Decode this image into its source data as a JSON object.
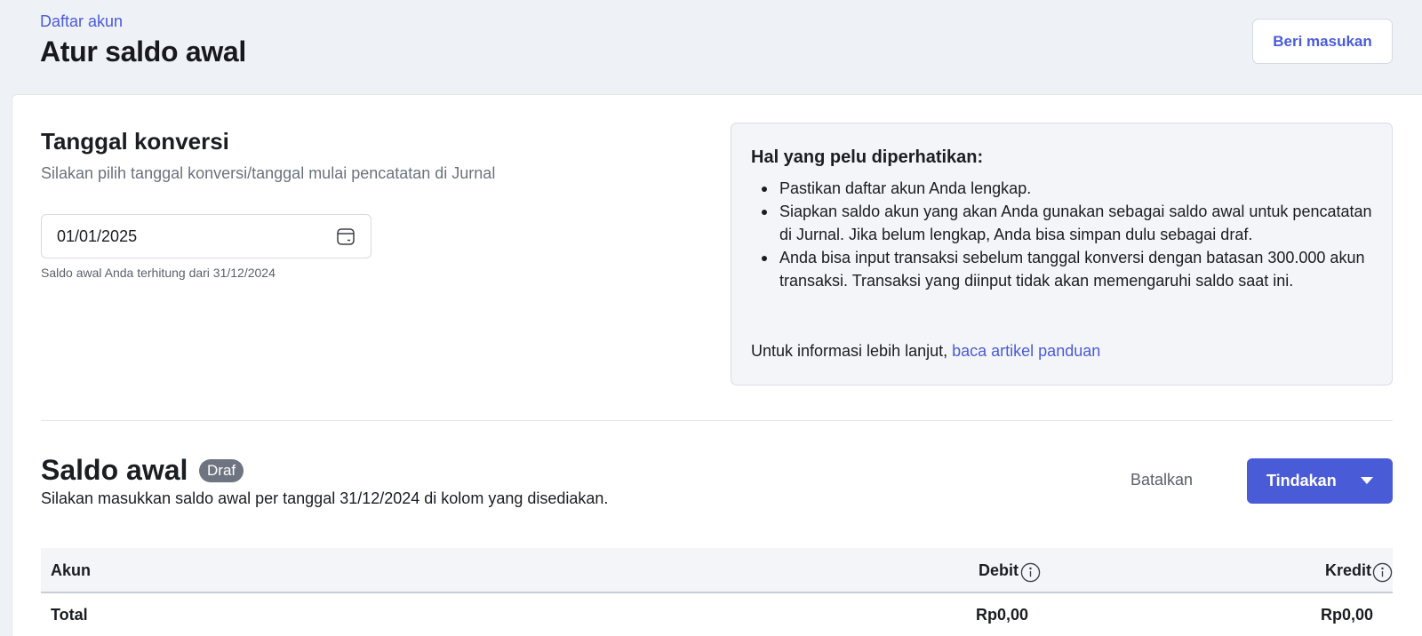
{
  "header": {
    "breadcrumb": "Daftar akun",
    "title": "Atur saldo awal",
    "feedback_label": "Beri masukan"
  },
  "conversion": {
    "title": "Tanggal konversi",
    "subtitle": "Silakan pilih tanggal konversi/tanggal mulai pencatatan di Jurnal",
    "date_value": "01/01/2025",
    "helper": "Saldo awal Anda terhitung dari 31/12/2024"
  },
  "info": {
    "title": "Hal yang pelu diperhatikan:",
    "items": [
      "Pastikan daftar akun Anda lengkap.",
      "Siapkan saldo akun yang akan Anda gunakan sebagai saldo awal untuk pencatatan di Jurnal. Jika belum lengkap, Anda bisa simpan dulu sebagai draf.",
      "Anda bisa input transaksi sebelum tanggal konversi dengan batasan 300.000 akun transaksi. Transaksi yang diinput tidak akan memengaruhi saldo saat ini."
    ],
    "more_prefix": "Untuk informasi lebih lanjut,",
    "more_link": "baca artikel panduan"
  },
  "opening_balance": {
    "title": "Saldo awal",
    "badge": "Draf",
    "subtitle": "Silakan masukkan saldo awal per tanggal 31/12/2024 di kolom yang disediakan.",
    "cancel_label": "Batalkan",
    "action_label": "Tindakan"
  },
  "table": {
    "columns": [
      "Akun",
      "Debit",
      "Kredit"
    ],
    "total": {
      "label": "Total",
      "debit": "Rp0,00",
      "kredit": "Rp0,00"
    }
  },
  "colors": {
    "accent": "#4a5bd8",
    "page_bg": "#eef1f6",
    "badge_bg": "#6e7480"
  }
}
